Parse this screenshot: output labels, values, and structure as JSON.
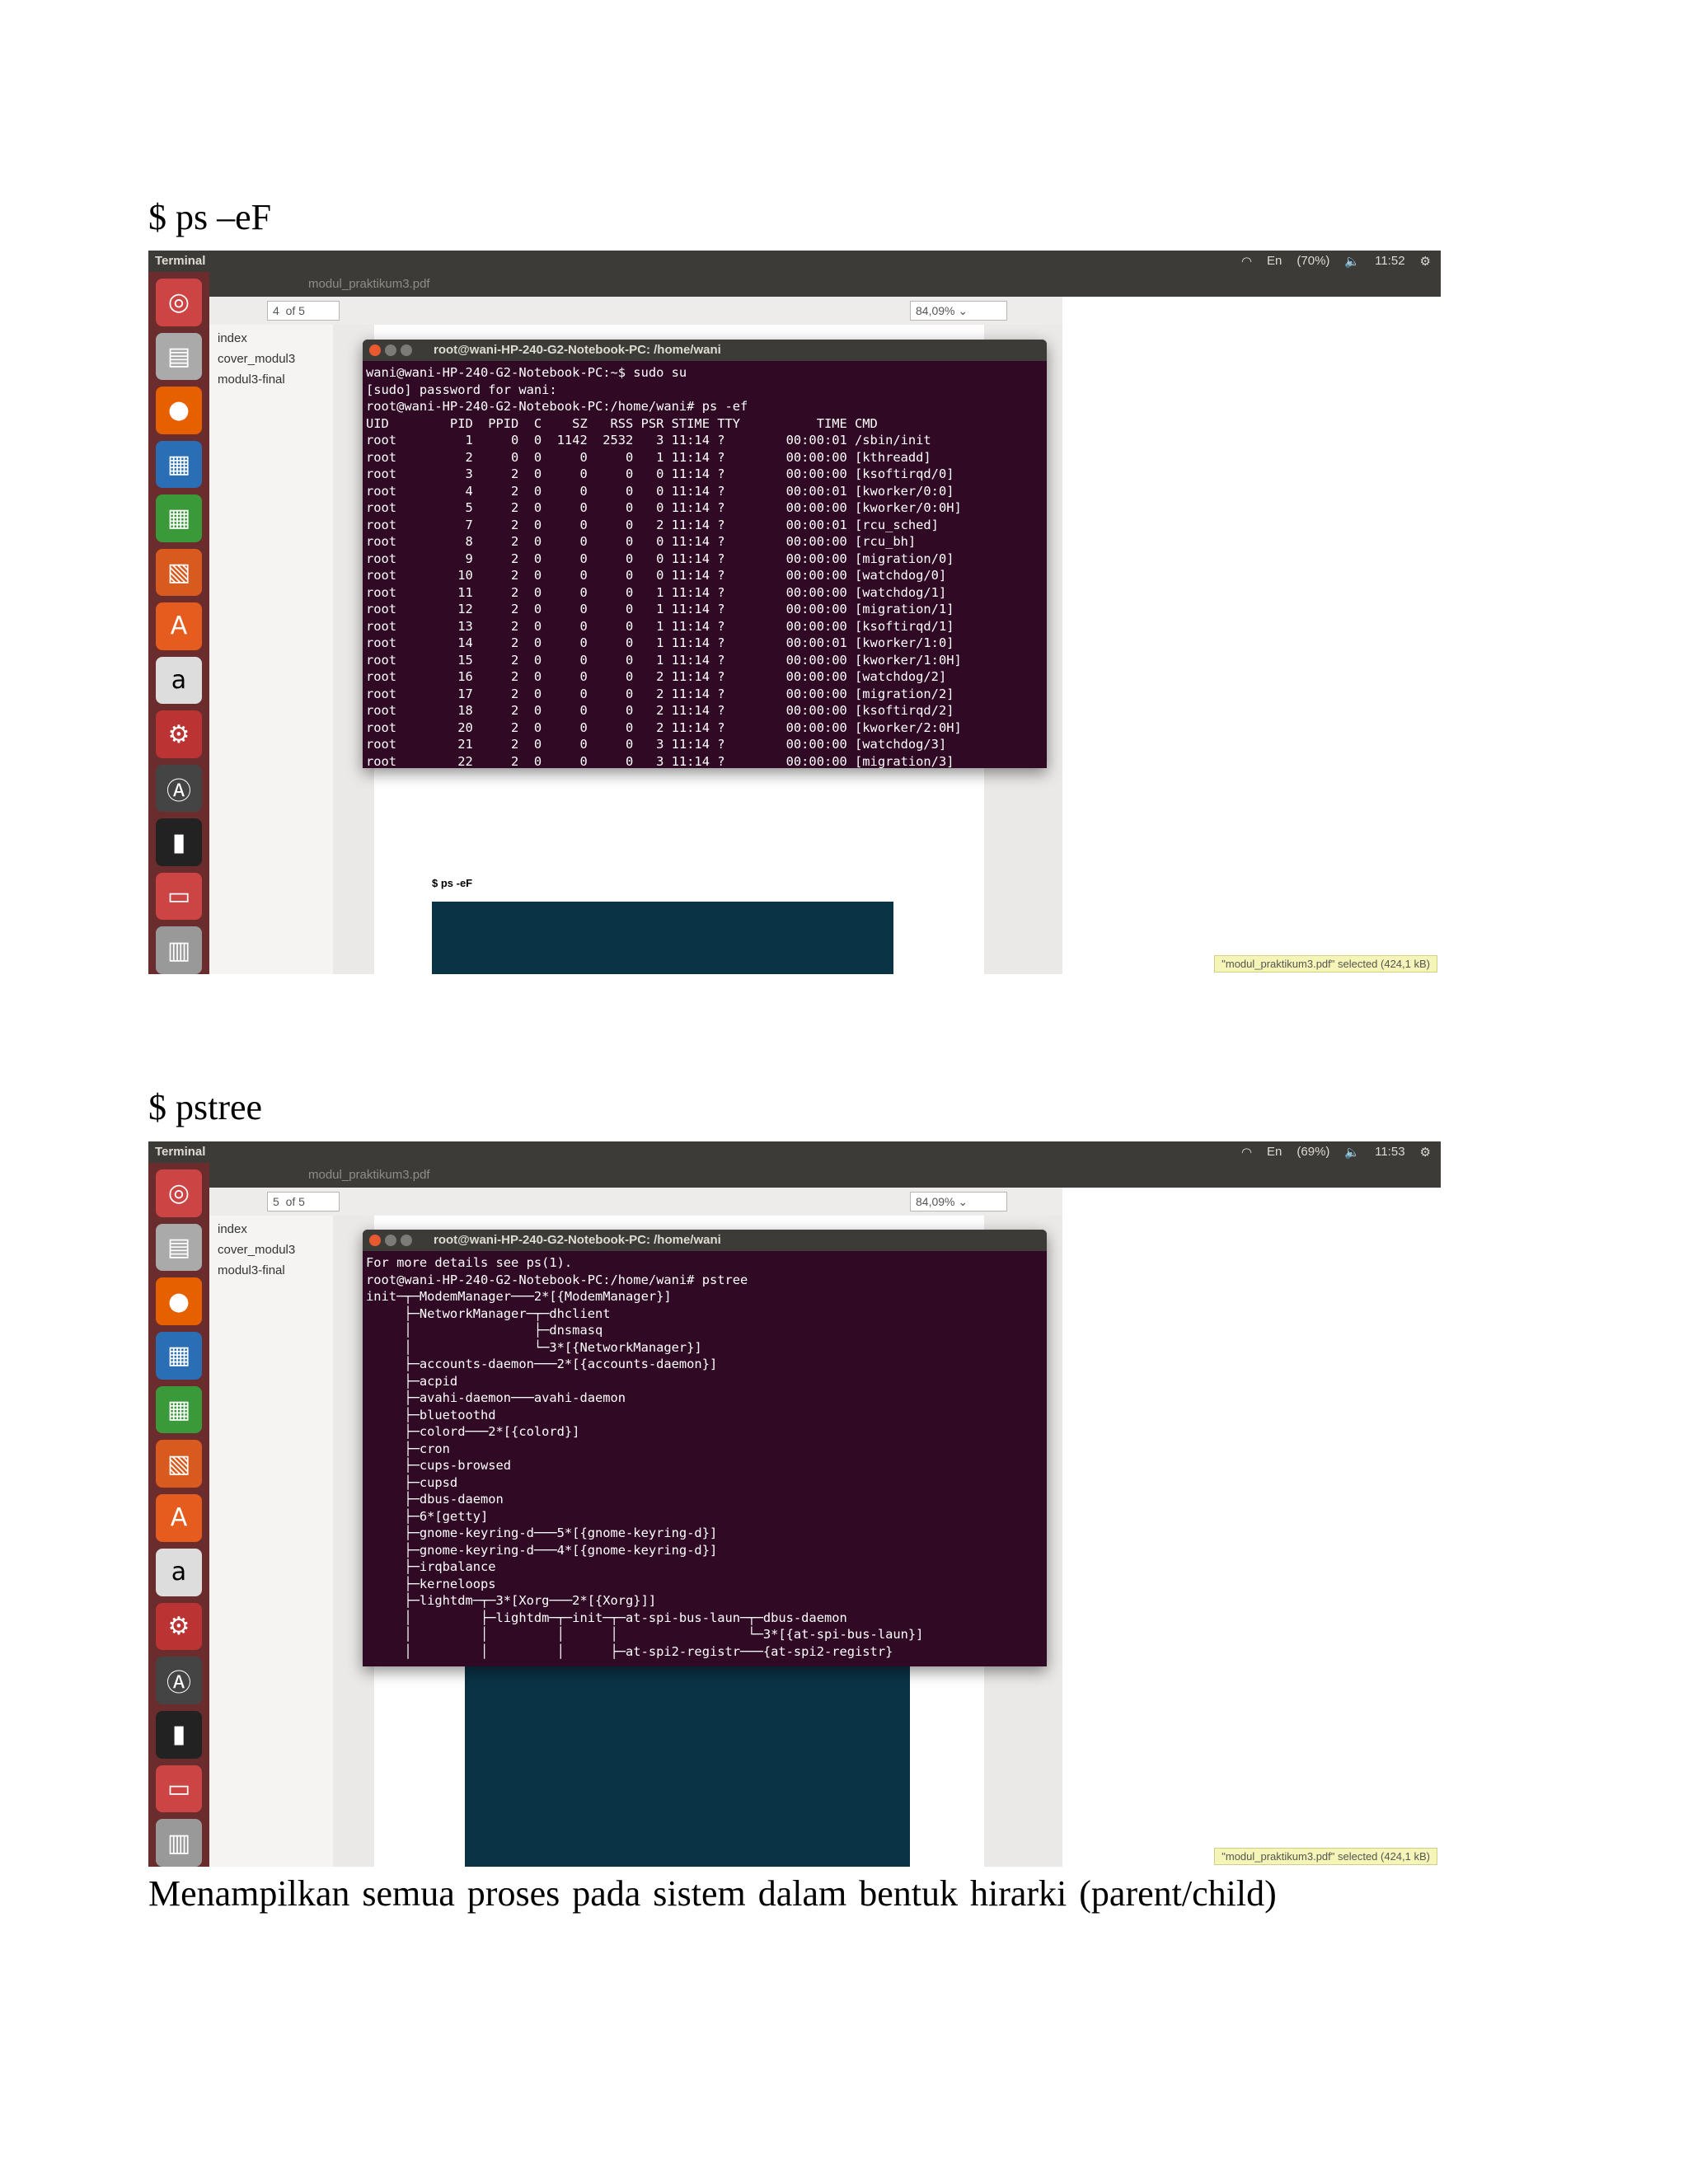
{
  "heading_ps": "$ ps –eF",
  "heading_pstree": "$ pstree",
  "caption": "Menampilkan  semua proses pada sistem dalam bentuk hirarki  (parent/child)",
  "screenshot1": {
    "topbar_title": "Terminal",
    "indicators": [
      "En",
      "(70%)",
      "11:52"
    ],
    "evince_title": "modul_praktikum3.pdf",
    "page_num": "4",
    "page_of": "of 5",
    "zoom": "84,09%",
    "sidebar": [
      "index",
      "cover_modul3",
      "modul3-final"
    ],
    "terminal_title": "root@wani-HP-240-G2-Notebook-PC: /home/wani",
    "terminal_lines": [
      "wani@wani-HP-240-G2-Notebook-PC:~$ sudo su",
      "[sudo] password for wani:",
      "root@wani-HP-240-G2-Notebook-PC:/home/wani# ps -ef",
      "UID        PID  PPID  C    SZ   RSS PSR STIME TTY          TIME CMD",
      "root         1     0  0  1142  2532   3 11:14 ?        00:00:01 /sbin/init",
      "root         2     0  0     0     0   1 11:14 ?        00:00:00 [kthreadd]",
      "root         3     2  0     0     0   0 11:14 ?        00:00:00 [ksoftirqd/0]",
      "root         4     2  0     0     0   0 11:14 ?        00:00:01 [kworker/0:0]",
      "root         5     2  0     0     0   0 11:14 ?        00:00:00 [kworker/0:0H]",
      "root         7     2  0     0     0   2 11:14 ?        00:00:01 [rcu_sched]",
      "root         8     2  0     0     0   0 11:14 ?        00:00:00 [rcu_bh]",
      "root         9     2  0     0     0   0 11:14 ?        00:00:00 [migration/0]",
      "root        10     2  0     0     0   0 11:14 ?        00:00:00 [watchdog/0]",
      "root        11     2  0     0     0   1 11:14 ?        00:00:00 [watchdog/1]",
      "root        12     2  0     0     0   1 11:14 ?        00:00:00 [migration/1]",
      "root        13     2  0     0     0   1 11:14 ?        00:00:00 [ksoftirqd/1]",
      "root        14     2  0     0     0   1 11:14 ?        00:00:01 [kworker/1:0]",
      "root        15     2  0     0     0   1 11:14 ?        00:00:00 [kworker/1:0H]",
      "root        16     2  0     0     0   2 11:14 ?        00:00:00 [watchdog/2]",
      "root        17     2  0     0     0   2 11:14 ?        00:00:00 [migration/2]",
      "root        18     2  0     0     0   2 11:14 ?        00:00:00 [ksoftirqd/2]",
      "root        20     2  0     0     0   2 11:14 ?        00:00:00 [kworker/2:0H]",
      "root        21     2  0     0     0   3 11:14 ?        00:00:00 [watchdog/3]",
      "root        22     2  0     0     0   3 11:14 ?        00:00:00 [migration/3]"
    ],
    "page_bullet": "$ ps -eF",
    "status": "\"modul_praktikum3.pdf\" selected (424,1 kB)"
  },
  "screenshot2": {
    "topbar_title": "Terminal",
    "indicators": [
      "En",
      "(69%)",
      "11:53"
    ],
    "evince_title": "modul_praktikum3.pdf",
    "page_num": "5",
    "page_of": "of 5",
    "zoom": "84,09%",
    "sidebar": [
      "index",
      "cover_modul3",
      "modul3-final"
    ],
    "terminal_title": "root@wani-HP-240-G2-Notebook-PC: /home/wani",
    "terminal_lines": [
      "For more details see ps(1).",
      "root@wani-HP-240-G2-Notebook-PC:/home/wani# pstree",
      "init─┬─ModemManager───2*[{ModemManager}]",
      "     ├─NetworkManager─┬─dhclient",
      "     │                ├─dnsmasq",
      "     │                └─3*[{NetworkManager}]",
      "     ├─accounts-daemon───2*[{accounts-daemon}]",
      "     ├─acpid",
      "     ├─avahi-daemon───avahi-daemon",
      "     ├─bluetoothd",
      "     ├─colord───2*[{colord}]",
      "     ├─cron",
      "     ├─cups-browsed",
      "     ├─cupsd",
      "     ├─dbus-daemon",
      "     ├─6*[getty]",
      "     ├─gnome-keyring-d───5*[{gnome-keyring-d}]",
      "     ├─gnome-keyring-d───4*[{gnome-keyring-d}]",
      "     ├─irqbalance",
      "     ├─kerneloops",
      "     ├─lightdm─┬─3*[Xorg───2*[{Xorg}]]",
      "     │         ├─lightdm─┬─init─┬─at-spi-bus-laun─┬─dbus-daemon",
      "     │         │         │      │                 └─3*[{at-spi-bus-laun}]",
      "     │         │         │      ├─at-spi2-registr───{at-spi2-registr}"
    ],
    "status": "\"modul_praktikum3.pdf\" selected (424,1 kB)"
  }
}
